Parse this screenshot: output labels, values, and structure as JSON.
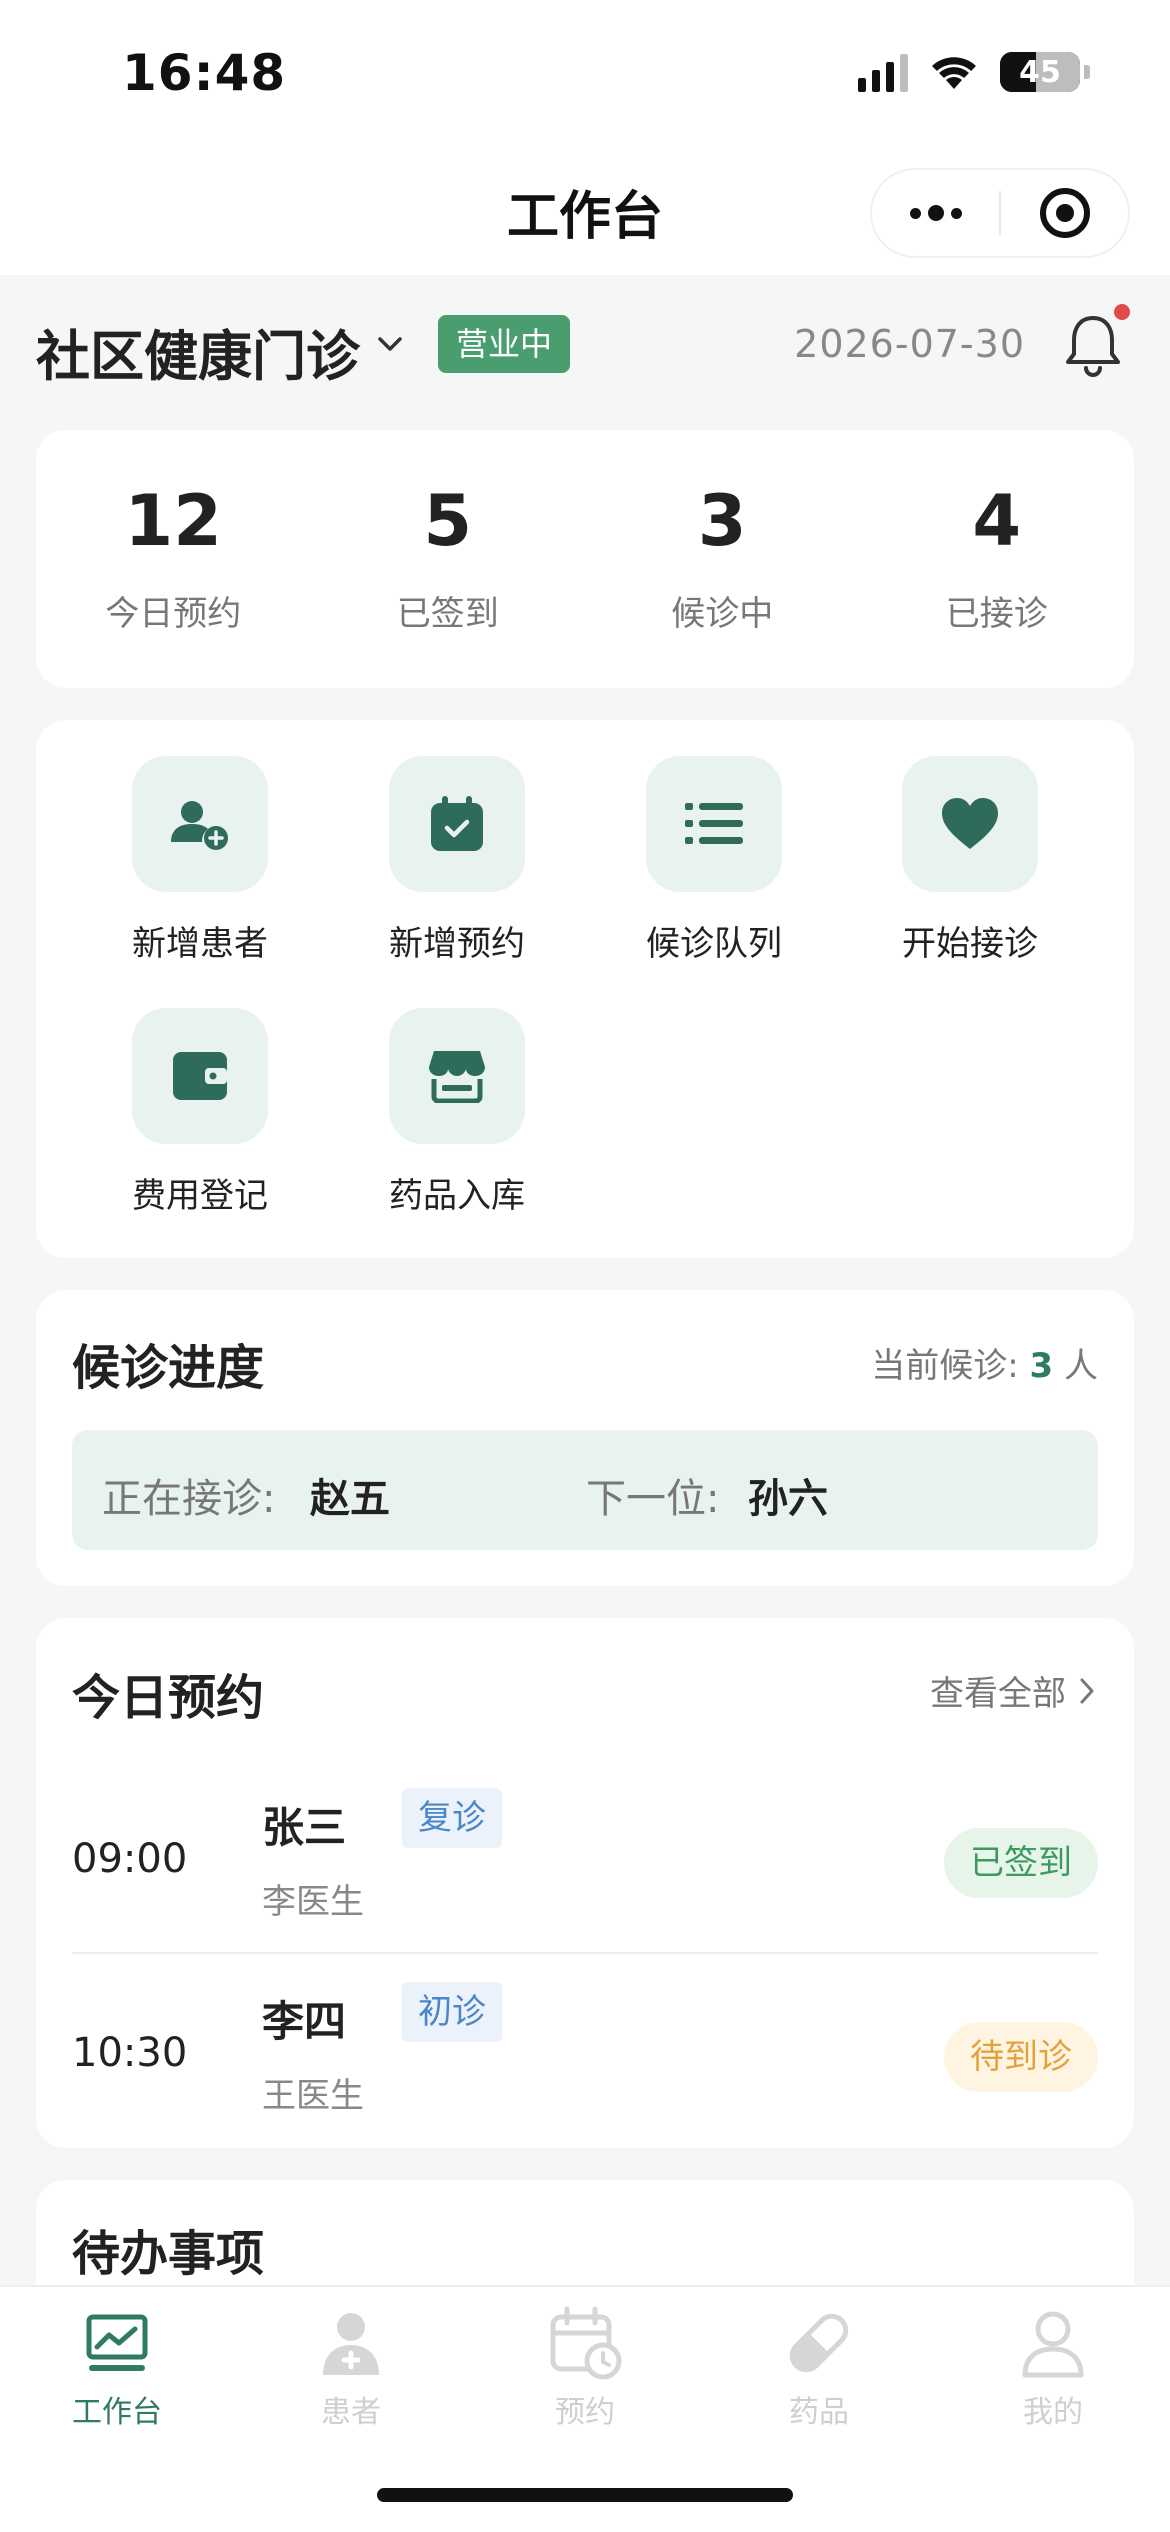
{
  "status_bar": {
    "time": "16:48",
    "battery": "45"
  },
  "navbar": {
    "title": "工作台"
  },
  "header": {
    "clinic": "社区健康门诊",
    "open_status": "营业中",
    "date": "2026-07-30"
  },
  "stats": [
    {
      "value": "12",
      "label": "今日预约"
    },
    {
      "value": "5",
      "label": "已签到"
    },
    {
      "value": "3",
      "label": "候诊中"
    },
    {
      "value": "4",
      "label": "已接诊"
    }
  ],
  "actions": [
    {
      "label": "新增患者",
      "icon": "add-user-icon"
    },
    {
      "label": "新增预约",
      "icon": "calendar-check-icon"
    },
    {
      "label": "候诊队列",
      "icon": "list-icon"
    },
    {
      "label": "开始接诊",
      "icon": "heart-icon"
    },
    {
      "label": "费用登记",
      "icon": "wallet-icon"
    },
    {
      "label": "药品入库",
      "icon": "store-icon"
    }
  ],
  "queue": {
    "title": "候诊进度",
    "count_prefix": "当前候诊:",
    "count": "3",
    "count_unit": "人",
    "current_label": "正在接诊:",
    "current_name": "赵五",
    "next_label": "下一位:",
    "next_name": "孙六"
  },
  "appointments": {
    "title": "今日预约",
    "view_all": "查看全部",
    "items": [
      {
        "time": "09:00",
        "name": "张三",
        "type": "复诊",
        "doctor": "李医生",
        "status": "已签到"
      },
      {
        "time": "10:30",
        "name": "李四",
        "type": "初诊",
        "doctor": "王医生",
        "status": "待到诊"
      }
    ]
  },
  "todo": {
    "title": "待办事项"
  },
  "tabbar": [
    {
      "label": "工作台",
      "icon": "dashboard-icon",
      "active": true
    },
    {
      "label": "患者",
      "icon": "patient-icon",
      "active": false
    },
    {
      "label": "预约",
      "icon": "calendar-clock-icon",
      "active": false
    },
    {
      "label": "药品",
      "icon": "pill-icon",
      "active": false
    },
    {
      "label": "我的",
      "icon": "profile-icon",
      "active": false
    }
  ],
  "colors": {
    "brand": "#2f7a63",
    "open_pill": "#4a9d6e",
    "tag_blue": "#4a86c8",
    "signed_green": "#3c9a5f",
    "pending_orange": "#e4a23a",
    "notification_dot": "#e24b4b"
  }
}
